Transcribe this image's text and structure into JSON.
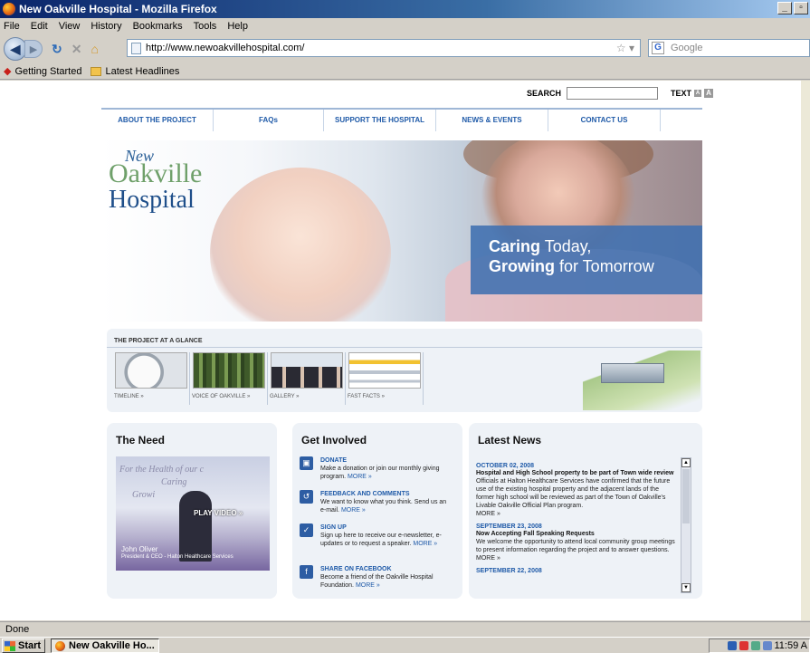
{
  "browser": {
    "title": "New Oakville Hospital - Mozilla Firefox",
    "menu": [
      "File",
      "Edit",
      "View",
      "History",
      "Bookmarks",
      "Tools",
      "Help"
    ],
    "url": "http://www.newoakvillehospital.com/",
    "search_placeholder": "Google",
    "bookmarks": [
      "Getting Started",
      "Latest Headlines"
    ],
    "status": "Done"
  },
  "taskbar": {
    "start": "Start",
    "task": "New Oakville Ho...",
    "clock": "11:59 A"
  },
  "site": {
    "search_label": "SEARCH",
    "text_label": "TEXT",
    "nav": [
      "ABOUT THE PROJECT",
      "FAQs",
      "SUPPORT THE HOSPITAL",
      "NEWS & EVENTS",
      "CONTACT US"
    ],
    "logo": {
      "new": "New",
      "oakville": "Oakville",
      "hospital": "Hospital"
    },
    "tagline": {
      "caring_bold": "Caring",
      "caring_rest": " Today,",
      "growing_bold": "Growing",
      "growing_rest": " for Tomorrow"
    },
    "glance": {
      "heading": "THE PROJECT AT A GLANCE",
      "items": [
        "TIMELINE »",
        "VOICE OF OAKVILLE »",
        "GALLERY »",
        "FAST FACTS »"
      ]
    },
    "need": {
      "heading": "The Need",
      "sign": [
        "For the Health of our c",
        "Caring",
        "Growi"
      ],
      "play": "PLAY VIDEO »",
      "name": "John Oliver",
      "role": "President & CEO - Halton Healthcare Services"
    },
    "involved": {
      "heading": "Get Involved",
      "items": [
        {
          "title": "DONATE",
          "text": "Make a donation or join our monthly giving program.",
          "more": "MORE »"
        },
        {
          "title": "FEEDBACK AND COMMENTS",
          "text": "We want to know what you think. Send us an e-mail.",
          "more": "MORE »"
        },
        {
          "title": "SIGN UP",
          "text": "Sign up here to receive our e-newsletter, e-updates or to request a speaker.",
          "more": "MORE »"
        },
        {
          "title": "SHARE ON FACEBOOK",
          "text": "Become a friend of the Oakville Hospital Foundation.",
          "more": "MORE »"
        }
      ]
    },
    "news": {
      "heading": "Latest News",
      "items": [
        {
          "date": "OCTOBER 02, 2008",
          "title": "Hospital and High School property to be part of Town wide review",
          "body": "Officials at Halton Healthcare Services have confirmed that the future use of the existing hospital property and the adjacent lands of the former high school will be reviewed as part of the Town of Oakville's Livable Oakville Official Plan program.",
          "more": "MORE »"
        },
        {
          "date": "SEPTEMBER 23, 2008",
          "title": "Now Accepting Fall Speaking Requests",
          "body": "We welcome the opportunity to attend local community group meetings to present information regarding the project and to answer questions.",
          "more": "MORE »"
        },
        {
          "date": "SEPTEMBER 22, 2008",
          "title": "",
          "body": "",
          "more": ""
        }
      ]
    }
  }
}
